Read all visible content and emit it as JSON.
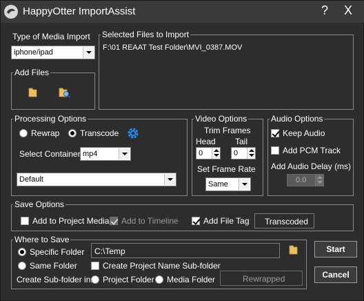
{
  "window": {
    "title": "HappyOtter ImportAssist",
    "help_label": "?",
    "close_label": "X"
  },
  "media_import": {
    "legend": "Type of Media Import",
    "selected": "iphone/ipad"
  },
  "add_files": {
    "legend": "Add Files"
  },
  "selected_files": {
    "legend": "Selected Files to Import",
    "items": [
      "F:\\01 REAAT Test Folder\\MVI_0387.MOV"
    ]
  },
  "processing": {
    "legend": "Processing Options",
    "rewrap_label": "Rewrap",
    "transcode_label": "Transcode",
    "mode": "transcode",
    "container_label": "Select Container",
    "container_value": "mp4",
    "preset_value": "Default"
  },
  "video": {
    "legend": "Video Options",
    "trim_label": "Trim Frames",
    "head_label": "Head",
    "tail_label": "Tail",
    "head_value": "0",
    "tail_value": "0",
    "frame_rate_label": "Set Frame Rate",
    "frame_rate_value": "Same"
  },
  "audio": {
    "legend": "Audio Options",
    "keep_audio_label": "Keep Audio",
    "keep_audio_checked": true,
    "pcm_label": "Add PCM Track",
    "pcm_checked": false,
    "delay_label": "Add Audio Delay (ms)",
    "delay_value": "0.0"
  },
  "save": {
    "legend": "Save Options",
    "project_media_label": "Add to Project Media",
    "project_media_checked": false,
    "timeline_label": "Add to Timeline",
    "timeline_checked": true,
    "file_tag_label": "Add File Tag",
    "file_tag_checked": true,
    "tag_value": "Transcoded"
  },
  "where": {
    "legend": "Where to Save",
    "specific_label": "Specific Folder",
    "same_label": "Same Folder",
    "location": "specific",
    "folder_path": "C:\\Temp",
    "subfolder_label": "Create Project Name Sub-folder",
    "subfolder_checked": false,
    "sub_in_label": "Create Sub-folder in:",
    "project_folder_label": "Project Folder",
    "media_folder_label": "Media Folder",
    "sub_target": "none",
    "rewrapped_value": "Rewrapped"
  },
  "actions": {
    "start_label": "Start",
    "cancel_label": "Cancel"
  },
  "colors": {
    "background": "#2d2d2d",
    "accent_gear": "#1e90ff",
    "folder": "#e8c060"
  }
}
